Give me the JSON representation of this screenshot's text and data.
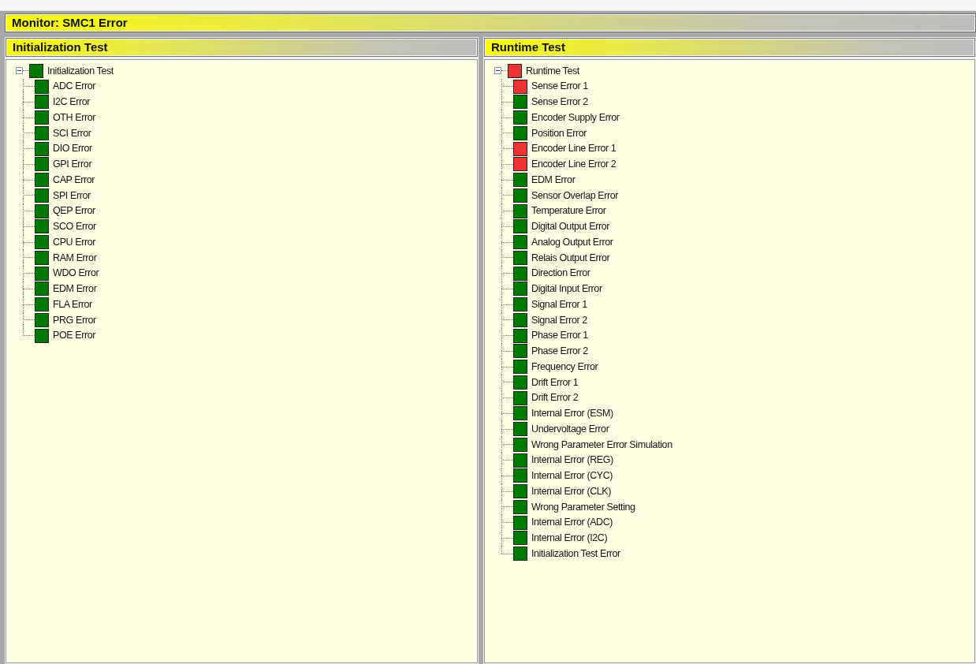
{
  "monitor": {
    "title": "Monitor: SMC1 Error"
  },
  "panels": [
    {
      "title": "Initialization Test",
      "tree": [
        {
          "label": "Initialization Test",
          "color": "#007a00",
          "expanded": true,
          "children": [
            {
              "label": "ADC Error",
              "color": "#007a00"
            },
            {
              "label": "I2C Error",
              "color": "#007a00"
            },
            {
              "label": "OTH Error",
              "color": "#007a00"
            },
            {
              "label": "SCI Error",
              "color": "#007a00"
            },
            {
              "label": "DIO Error",
              "color": "#007a00"
            },
            {
              "label": "GPI Error",
              "color": "#007a00"
            },
            {
              "label": "CAP Error",
              "color": "#007a00"
            },
            {
              "label": "SPI Error",
              "color": "#007a00"
            },
            {
              "label": "QEP Error",
              "color": "#007a00"
            },
            {
              "label": "SCO Error",
              "color": "#007a00"
            },
            {
              "label": "CPU Error",
              "color": "#007a00"
            },
            {
              "label": "RAM Error",
              "color": "#007a00"
            },
            {
              "label": "WDO Error",
              "color": "#007a00"
            },
            {
              "label": "EDM Error",
              "color": "#007a00"
            },
            {
              "label": "FLA Error",
              "color": "#007a00"
            },
            {
              "label": "PRG Error",
              "color": "#007a00"
            },
            {
              "label": "POE Error",
              "color": "#007a00"
            }
          ]
        }
      ]
    },
    {
      "title": "Runtime Test",
      "tree": [
        {
          "label": "Runtime Test",
          "color": "#f03232",
          "expanded": true,
          "children": [
            {
              "label": "Sense Error 1",
              "color": "#f03232"
            },
            {
              "label": "Sense Error 2",
              "color": "#007a00"
            },
            {
              "label": "Encoder Supply Error",
              "color": "#007a00"
            },
            {
              "label": "Position Error",
              "color": "#007a00"
            },
            {
              "label": "Encoder Line Error 1",
              "color": "#f03232"
            },
            {
              "label": "Encoder Line Error 2",
              "color": "#f03232"
            },
            {
              "label": "EDM Error",
              "color": "#007a00"
            },
            {
              "label": "Sensor Overlap Error",
              "color": "#007a00"
            },
            {
              "label": "Temperature Error",
              "color": "#007a00"
            },
            {
              "label": "Digital Output Error",
              "color": "#007a00"
            },
            {
              "label": "Analog Output Error",
              "color": "#007a00"
            },
            {
              "label": "Relais Output Error",
              "color": "#007a00"
            },
            {
              "label": "Direction Error",
              "color": "#007a00"
            },
            {
              "label": "Digital Input Error",
              "color": "#007a00"
            },
            {
              "label": "Signal Error 1",
              "color": "#007a00"
            },
            {
              "label": "Signal Error 2",
              "color": "#007a00"
            },
            {
              "label": "Phase Error 1",
              "color": "#007a00"
            },
            {
              "label": "Phase Error 2",
              "color": "#007a00"
            },
            {
              "label": "Frequency Error",
              "color": "#007a00"
            },
            {
              "label": "Drift Error 1",
              "color": "#007a00"
            },
            {
              "label": "Drift Error 2",
              "color": "#007a00"
            },
            {
              "label": "Internal Error (ESM)",
              "color": "#007a00"
            },
            {
              "label": "Undervoltage Error",
              "color": "#007a00"
            },
            {
              "label": "Wrong Parameter Error Simulation",
              "color": "#007a00"
            },
            {
              "label": "Internal Error (REG)",
              "color": "#007a00"
            },
            {
              "label": "Internal Error (CYC)",
              "color": "#007a00"
            },
            {
              "label": "Internal Error (CLK)",
              "color": "#007a00"
            },
            {
              "label": "Wrong Parameter Setting",
              "color": "#007a00"
            },
            {
              "label": "Internal Error (ADC)",
              "color": "#007a00"
            },
            {
              "label": "Internal Error (I2C)",
              "color": "#007a00"
            },
            {
              "label": "Initialization Test Error",
              "color": "#007a00"
            }
          ]
        }
      ]
    }
  ]
}
